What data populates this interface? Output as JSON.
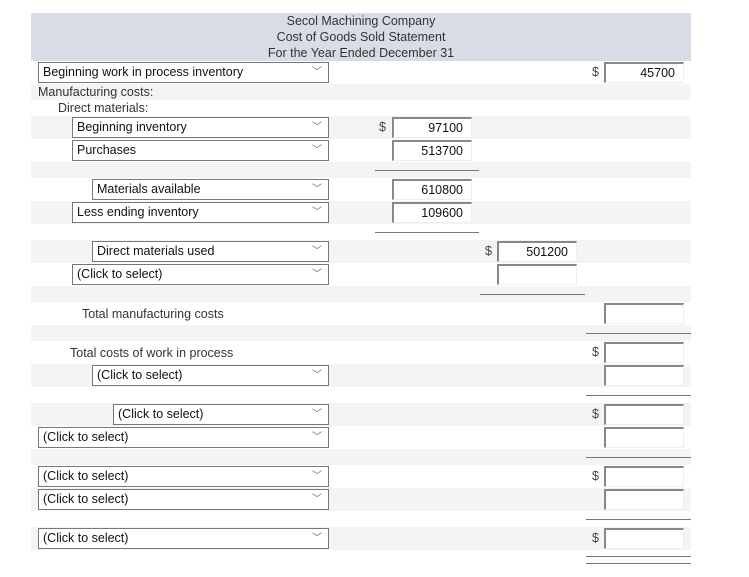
{
  "header": {
    "company": "Secol Machining Company",
    "statement": "Cost of Goods Sold Statement",
    "period": "For the Year Ended December 31"
  },
  "currency_symbol": "$",
  "rows": {
    "beginning_wip": {
      "label": "Beginning work in process inventory",
      "value": "45700"
    },
    "manufacturing_costs": {
      "label": "Manufacturing costs:"
    },
    "direct_materials": {
      "label": "Direct materials:"
    },
    "beginning_inventory": {
      "label": "Beginning inventory",
      "value": "97100"
    },
    "purchases": {
      "label": "Purchases",
      "value": "513700"
    },
    "materials_available": {
      "label": "Materials available",
      "value": "610800"
    },
    "less_ending_inventory": {
      "label": "Less ending inventory",
      "value": "109600"
    },
    "direct_materials_used": {
      "label": "Direct materials used",
      "value": "501200"
    },
    "select_1": {
      "label": "(Click to select)",
      "value": ""
    },
    "total_manufacturing_costs": {
      "label": "Total manufacturing costs",
      "value": ""
    },
    "total_costs_wip": {
      "label": "Total costs of work in process",
      "value": ""
    },
    "select_2": {
      "label": "(Click to select)",
      "value": ""
    },
    "select_3": {
      "label": "(Click to select)",
      "value": ""
    },
    "select_4": {
      "label": "(Click to select)",
      "value": ""
    },
    "select_5": {
      "label": "(Click to select)",
      "value": ""
    },
    "select_6": {
      "label": "(Click to select)",
      "value": ""
    },
    "select_7": {
      "label": "(Click to select)",
      "value": ""
    }
  },
  "dropdown_chevron": "﹀"
}
